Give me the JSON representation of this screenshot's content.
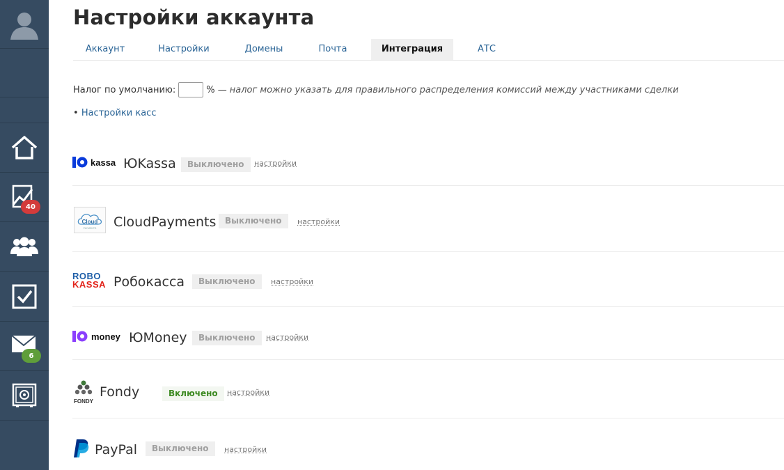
{
  "page": {
    "title": "Настройки аккаунта"
  },
  "tabs": [
    {
      "label": "Аккаунт",
      "active": false
    },
    {
      "label": "Настройки",
      "active": false
    },
    {
      "label": "Домены",
      "active": false
    },
    {
      "label": "Почта",
      "active": false
    },
    {
      "label": "Интеграция",
      "active": true
    },
    {
      "label": "АТС",
      "active": false
    }
  ],
  "sidebar": {
    "items": [
      {
        "icon": "user-avatar-icon"
      },
      {
        "icon": "home-icon"
      },
      {
        "icon": "chart-icon",
        "badge": "40",
        "badge_color": "#d33b3b"
      },
      {
        "icon": "users-icon"
      },
      {
        "icon": "checkbox-icon"
      },
      {
        "icon": "envelope-icon",
        "badge": "6",
        "badge_color": "#5f9e3a"
      },
      {
        "icon": "safe-icon"
      }
    ]
  },
  "tax": {
    "label": "Налог по умолчанию:",
    "value": "",
    "unit": "% —",
    "note": "налог можно указать для правильного распределения комиссий между участниками сделки"
  },
  "kassa_link": {
    "bullet": "•",
    "label": "Настройки касс"
  },
  "integrations": [
    {
      "name": "ЮKassa",
      "logo_text": "kassa",
      "status": "Выключено",
      "enabled": false,
      "settings": "настройки"
    },
    {
      "name": "CloudPayments",
      "logo_text": "Cloud",
      "logo_subtext": "PAYMENTS",
      "status": "Выключено",
      "enabled": false,
      "settings": "настройки"
    },
    {
      "name": "Робокасса",
      "logo_text": "ROBO",
      "logo_text2": "KASSA",
      "status": "Выключено",
      "enabled": false,
      "settings": "настройки"
    },
    {
      "name": "ЮMoney",
      "logo_text": "money",
      "status": "Выключено",
      "enabled": false,
      "settings": "настройки"
    },
    {
      "name": "Fondy",
      "logo_text": "FONDY",
      "status": "Включено",
      "enabled": true,
      "settings": "настройки"
    },
    {
      "name": "PayPal",
      "status": "Выключено",
      "enabled": false,
      "settings": "настройки"
    }
  ],
  "colors": {
    "sidebar": "#364b61",
    "link": "#2a6496",
    "enabled": "#3d8a22",
    "disabled_bg": "#efefef",
    "yookassa_blue": "#0a3bdb",
    "yoomoney_purple": "#8b3ffd",
    "robo_blue": "#1f5fa8",
    "robo_red": "#e2231a",
    "paypal_dark": "#003087",
    "paypal_light": "#009cde"
  }
}
